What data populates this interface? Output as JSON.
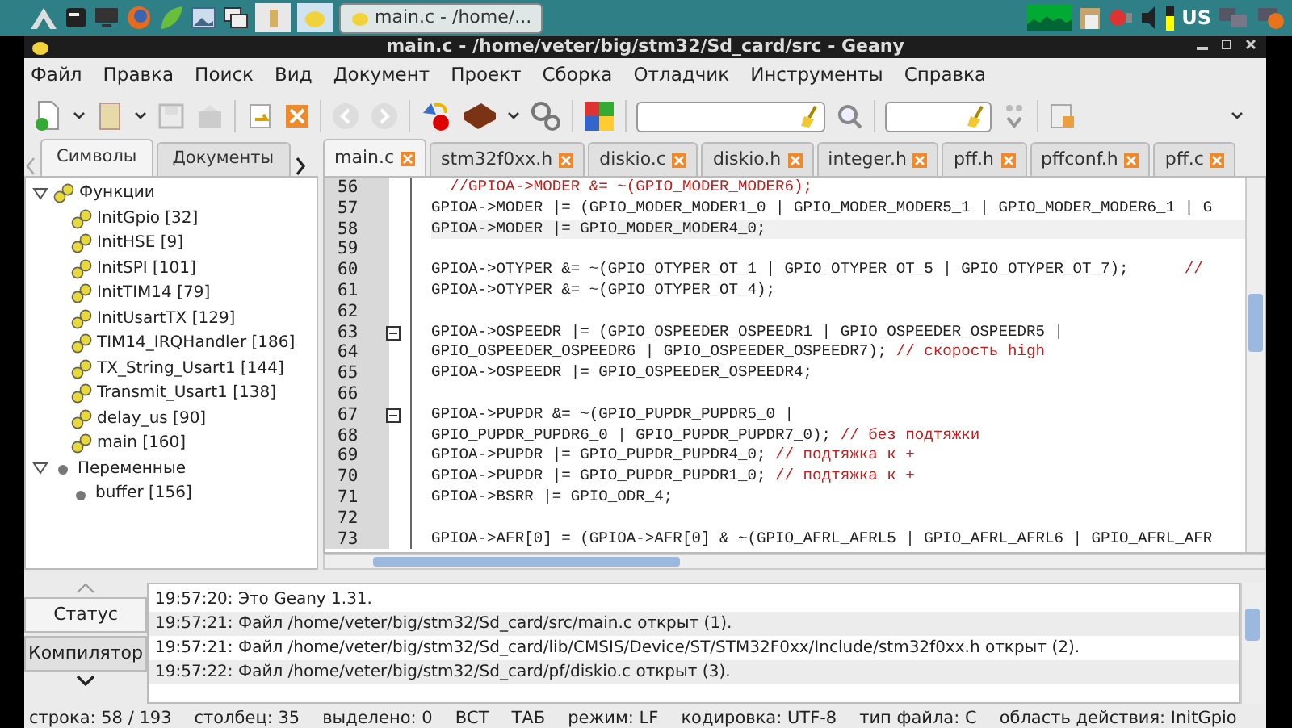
{
  "taskbar": {
    "window_button": "main.c - /home/...",
    "tray_layout": "US"
  },
  "window": {
    "title": "main.c - /home/veter/big/stm32/Sd_card/src - Geany"
  },
  "menu": [
    "Файл",
    "Правка",
    "Поиск",
    "Вид",
    "Документ",
    "Проект",
    "Сборка",
    "Отладчик",
    "Инструменты",
    "Справка"
  ],
  "sidebar": {
    "tabs": [
      {
        "label": "Символы",
        "selected": true
      },
      {
        "label": "Документы",
        "selected": false
      }
    ],
    "tree": [
      {
        "label": "Функции",
        "kind": "group",
        "expanded": true,
        "children": [
          {
            "label": "InitGpio [32]",
            "kind": "function"
          },
          {
            "label": "InitHSE [9]",
            "kind": "function"
          },
          {
            "label": "InitSPI [101]",
            "kind": "function"
          },
          {
            "label": "InitTIM14 [79]",
            "kind": "function"
          },
          {
            "label": "InitUsartTX [129]",
            "kind": "function"
          },
          {
            "label": "TIM14_IRQHandler [186]",
            "kind": "function"
          },
          {
            "label": "TX_String_Usart1 [144]",
            "kind": "function"
          },
          {
            "label": "Transmit_Usart1 [138]",
            "kind": "function"
          },
          {
            "label": "delay_us [90]",
            "kind": "function"
          },
          {
            "label": "main [160]",
            "kind": "function"
          }
        ]
      },
      {
        "label": "Переменные",
        "kind": "group",
        "expanded": true,
        "children": [
          {
            "label": "buffer [156]",
            "kind": "variable"
          }
        ]
      }
    ]
  },
  "editor": {
    "tabs": [
      {
        "label": "main.c",
        "selected": true
      },
      {
        "label": "stm32f0xx.h",
        "selected": false
      },
      {
        "label": "diskio.c",
        "selected": false
      },
      {
        "label": "diskio.h",
        "selected": false
      },
      {
        "label": "integer.h",
        "selected": false
      },
      {
        "label": "pff.h",
        "selected": false
      },
      {
        "label": "pffconf.h",
        "selected": false
      },
      {
        "label": "pff.c",
        "selected": false
      }
    ],
    "lines": [
      {
        "number": "56",
        "current": false,
        "fold": false,
        "comment": "  //GPIOA->MODER &= ~(GPIO_MODER_MODER6);"
      },
      {
        "number": "57",
        "current": false,
        "fold": false,
        "code": "GPIOA->MODER |= (GPIO_MODER_MODER1_0 | GPIO_MODER_MODER5_1 | GPIO_MODER_MODER6_1 | G"
      },
      {
        "number": "58",
        "current": true,
        "fold": false,
        "code": "GPIOA->MODER |= GPIO_MODER_MODER4_0;"
      },
      {
        "number": "59",
        "current": false,
        "fold": false
      },
      {
        "number": "60",
        "current": false,
        "fold": false,
        "code": "GPIOA->OTYPER &= ~(GPIO_OTYPER_OT_1 | GPIO_OTYPER_OT_5 | GPIO_OTYPER_OT_7);      ",
        "comment": "//"
      },
      {
        "number": "61",
        "current": false,
        "fold": false,
        "code": "GPIOA->OTYPER &= ~(GPIO_OTYPER_OT_4);"
      },
      {
        "number": "62",
        "current": false,
        "fold": false
      },
      {
        "number": "63",
        "current": false,
        "fold": true,
        "code": "GPIOA->OSPEEDR |= (GPIO_OSPEEDER_OSPEEDR1 | GPIO_OSPEEDER_OSPEEDR5 |"
      },
      {
        "number": "64",
        "current": false,
        "fold": false,
        "code": "GPIO_OSPEEDER_OSPEEDR6 | GPIO_OSPEEDER_OSPEEDR7); ",
        "comment": "// скорость high"
      },
      {
        "number": "65",
        "current": false,
        "fold": false,
        "code": "GPIOA->OSPEEDR |= GPIO_OSPEEDER_OSPEEDR4;"
      },
      {
        "number": "66",
        "current": false,
        "fold": false
      },
      {
        "number": "67",
        "current": false,
        "fold": true,
        "code": "GPIOA->PUPDR &= ~(GPIO_PUPDR_PUPDR5_0 |"
      },
      {
        "number": "68",
        "current": false,
        "fold": false,
        "code": "GPIO_PUPDR_PUPDR6_0 | GPIO_PUPDR_PUPDR7_0); ",
        "comment": "// без подтяжки"
      },
      {
        "number": "69",
        "current": false,
        "fold": false,
        "code": "GPIOA->PUPDR |= GPIO_PUPDR_PUPDR4_0; ",
        "comment": "// подтяжка к +"
      },
      {
        "number": "70",
        "current": false,
        "fold": false,
        "code": "GPIOA->PUPDR |= GPIO_PUPDR_PUPDR1_0; ",
        "comment": "// подтяжка к +"
      },
      {
        "number": "71",
        "current": false,
        "fold": false,
        "code": "GPIOA->BSRR |= GPIO_ODR_4;"
      },
      {
        "number": "72",
        "current": false,
        "fold": false
      },
      {
        "number": "73",
        "current": false,
        "fold": false,
        "code": "GPIOA->AFR[0] = (GPIOA->AFR[0] & ~(GPIO_AFRL_AFRL5 | GPIO_AFRL_AFRL6 | GPIO_AFRL_AFR"
      }
    ]
  },
  "messages": {
    "tabs": [
      {
        "label": "Статус",
        "selected": true
      },
      {
        "label": "Компилятор",
        "selected": false
      }
    ],
    "lines": [
      "19:57:20: Это Geany 1.31.",
      "19:57:21: Файл /home/veter/big/stm32/Sd_card/src/main.c открыт (1).",
      "19:57:21: Файл /home/veter/big/stm32/Sd_card/lib/CMSIS/Device/ST/STM32F0xx/Include/stm32f0xx.h открыт (2).",
      "19:57:22: Файл /home/veter/big/stm32/Sd_card/pf/diskio.c открыт (3)."
    ]
  },
  "status_bar": [
    "строка: 58 / 193",
    "столбец: 35",
    "выделено: 0",
    "ВСТ",
    "ТАБ",
    "режим: LF",
    "кодировка: UTF-8",
    "тип файла: C",
    "область действия: InitGpio"
  ]
}
